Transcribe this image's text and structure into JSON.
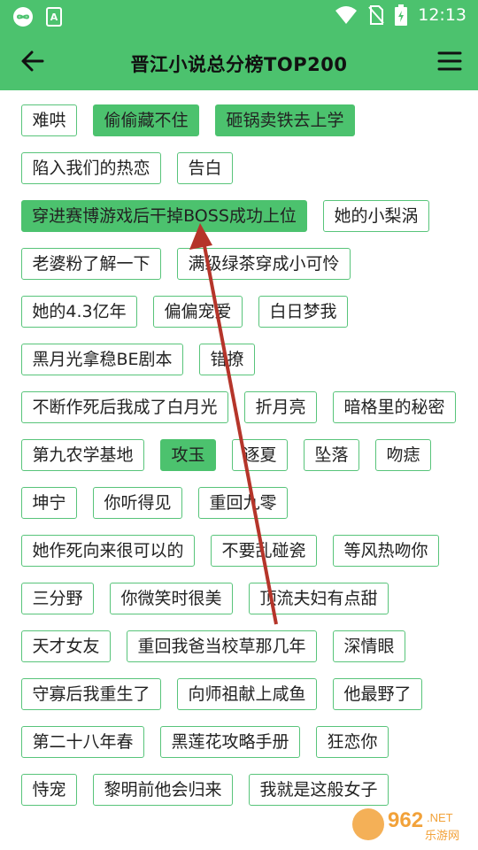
{
  "status": {
    "time": "12:13"
  },
  "header": {
    "title": "晋江小说总分榜TOP200"
  },
  "tags": [
    {
      "label": "难哄",
      "selected": false
    },
    {
      "label": "偷偷藏不住",
      "selected": true
    },
    {
      "label": "砸锅卖铁去上学",
      "selected": true
    },
    {
      "label": "陷入我们的热恋",
      "selected": false
    },
    {
      "label": "告白",
      "selected": false
    },
    {
      "label": "穿进赛博游戏后干掉BOSS成功上位",
      "selected": true
    },
    {
      "label": "她的小梨涡",
      "selected": false
    },
    {
      "label": "老婆粉了解一下",
      "selected": false
    },
    {
      "label": "满级绿茶穿成小可怜",
      "selected": false
    },
    {
      "label": "她的4.3亿年",
      "selected": false
    },
    {
      "label": "偏偏宠爱",
      "selected": false
    },
    {
      "label": "白日梦我",
      "selected": false
    },
    {
      "label": "黑月光拿稳BE剧本",
      "selected": false
    },
    {
      "label": "错撩",
      "selected": false
    },
    {
      "label": "不断作死后我成了白月光",
      "selected": false
    },
    {
      "label": "折月亮",
      "selected": false
    },
    {
      "label": "暗格里的秘密",
      "selected": false
    },
    {
      "label": "第九农学基地",
      "selected": false
    },
    {
      "label": "攻玉",
      "selected": true
    },
    {
      "label": "逐夏",
      "selected": false
    },
    {
      "label": "坠落",
      "selected": false
    },
    {
      "label": "吻痣",
      "selected": false
    },
    {
      "label": "坤宁",
      "selected": false
    },
    {
      "label": "你听得见",
      "selected": false
    },
    {
      "label": "重回九零",
      "selected": false
    },
    {
      "label": "她作死向来很可以的",
      "selected": false
    },
    {
      "label": "不要乱碰瓷",
      "selected": false
    },
    {
      "label": "等风热吻你",
      "selected": false
    },
    {
      "label": "三分野",
      "selected": false
    },
    {
      "label": "你微笑时很美",
      "selected": false
    },
    {
      "label": "顶流夫妇有点甜",
      "selected": false
    },
    {
      "label": "天才女友",
      "selected": false
    },
    {
      "label": "重回我爸当校草那几年",
      "selected": false
    },
    {
      "label": "深情眼",
      "selected": false
    },
    {
      "label": "守寡后我重生了",
      "selected": false
    },
    {
      "label": "向师祖献上咸鱼",
      "selected": false
    },
    {
      "label": "他最野了",
      "selected": false
    },
    {
      "label": "第二十八年春",
      "selected": false
    },
    {
      "label": "黑莲花攻略手册",
      "selected": false
    },
    {
      "label": "狂恋你",
      "selected": false
    },
    {
      "label": "恃宠",
      "selected": false
    },
    {
      "label": "黎明前他会归来",
      "selected": false
    },
    {
      "label": "我就是这般女子",
      "selected": false
    }
  ],
  "watermark": {
    "brand": "962",
    "suffix": ".NET",
    "subtitle": "乐游网"
  },
  "colors": {
    "accent": "#4cc26e",
    "border": "#58c47a",
    "arrow": "#b5352a"
  },
  "icons": [
    "infinity-icon",
    "app-a-icon",
    "wifi-icon",
    "no-sim-icon",
    "battery-icon",
    "back-arrow-icon",
    "menu-icon"
  ]
}
